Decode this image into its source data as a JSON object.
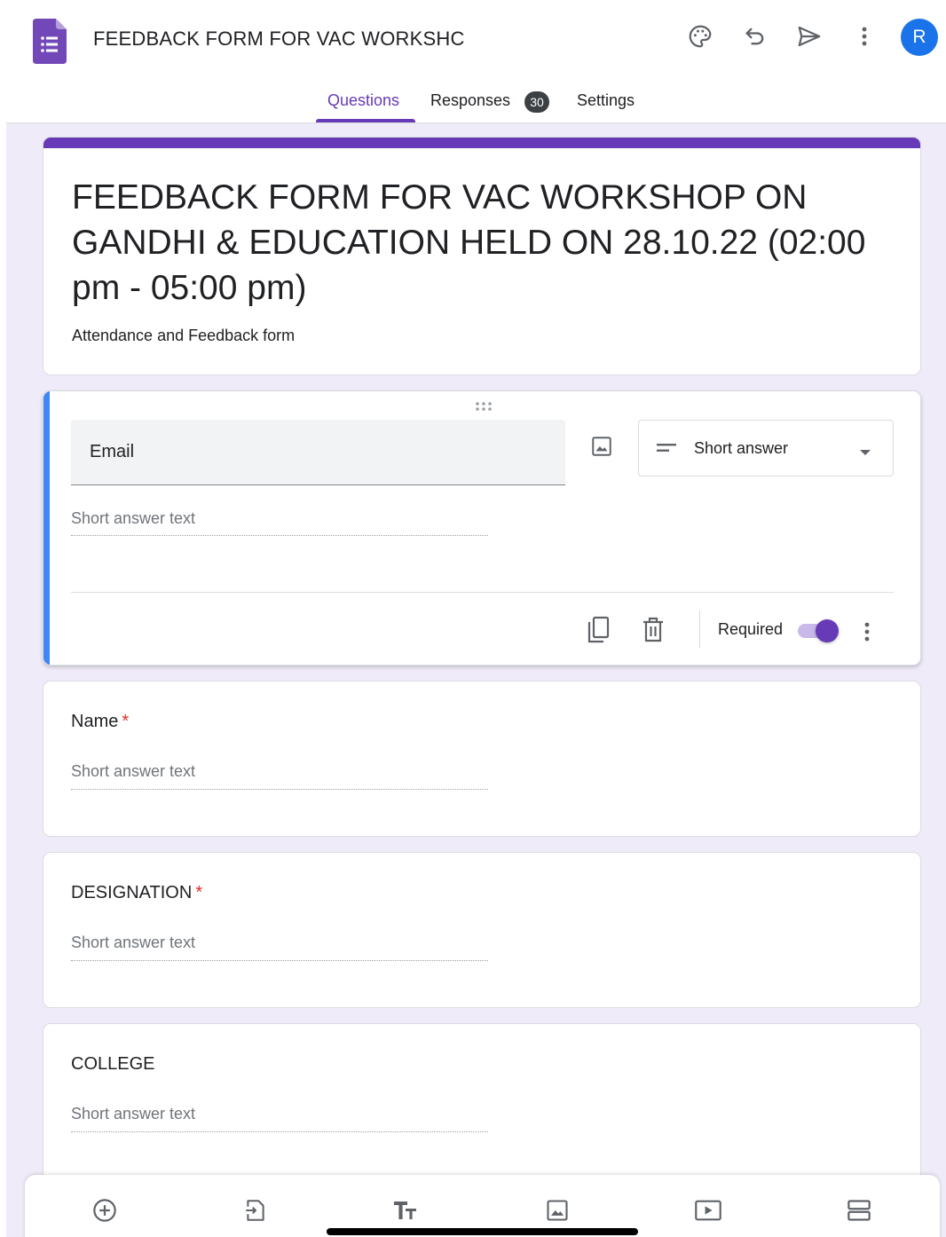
{
  "header": {
    "title": "FEEDBACK FORM FOR VAC WORKSHC",
    "avatar_letter": "R",
    "icons": [
      "palette-icon",
      "undo-icon",
      "send-icon",
      "more-vert-icon"
    ]
  },
  "tabs": {
    "questions": "Questions",
    "responses": "Responses",
    "responses_count": "30",
    "settings": "Settings"
  },
  "form": {
    "title": "FEEDBACK FORM FOR VAC WORKSHOP ON GANDHI & EDUCATION HELD ON 28.10.22 (02:00 pm - 05:00 pm)",
    "description": "Attendance and Feedback form"
  },
  "active_question": {
    "title": "Email",
    "type": "Short answer",
    "placeholder": "Short answer text",
    "required_label": "Required",
    "required": true
  },
  "questions": [
    {
      "title": "Name",
      "required_mark": "*",
      "placeholder": "Short answer text"
    },
    {
      "title": "DESIGNATION",
      "required_mark": "*",
      "placeholder": "Short answer text"
    },
    {
      "title": "COLLEGE",
      "required_mark": "",
      "placeholder": "Short answer text"
    }
  ],
  "toolbar": {
    "icons": [
      "add-question-icon",
      "import-questions-icon",
      "add-title-icon",
      "add-image-icon",
      "add-video-icon",
      "add-section-icon"
    ]
  },
  "colors": {
    "accent": "#673ab7",
    "active_bar": "#4285f4",
    "canvas": "#efebf8",
    "avatar": "#1a73e8",
    "required": "#d93025"
  }
}
